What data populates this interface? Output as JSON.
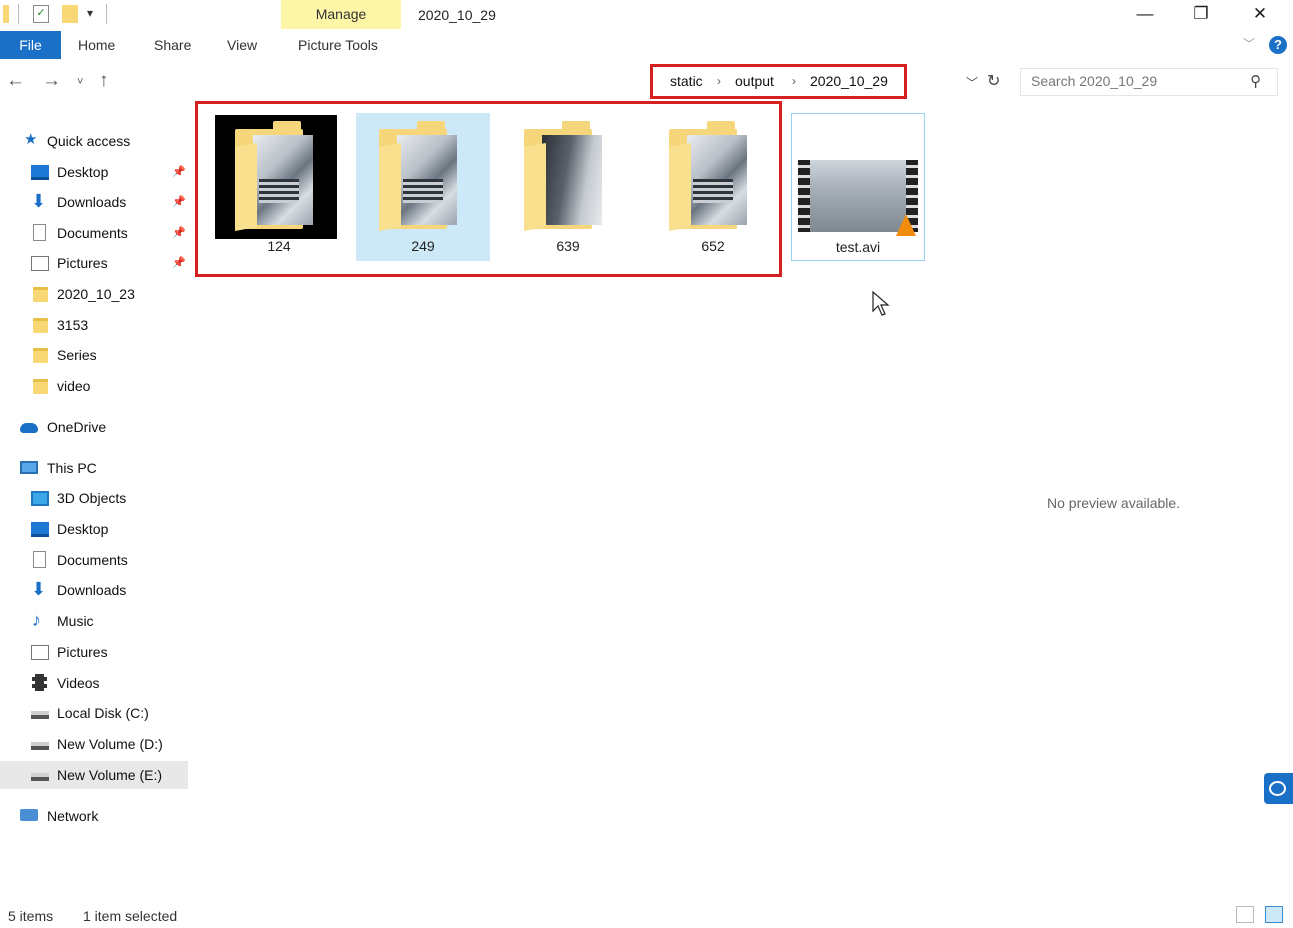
{
  "window": {
    "title": "2020_10_29",
    "contextual_tab": "Manage",
    "contextual_group": "Picture Tools",
    "minimize": "—",
    "maximize": "❐",
    "close": "✕"
  },
  "ribbon": {
    "tabs": [
      "File",
      "Home",
      "Share",
      "View",
      "Picture Tools"
    ],
    "help": "?"
  },
  "address": {
    "crumbs": [
      "static",
      "output",
      "2020_10_29"
    ],
    "search_placeholder": "Search 2020_10_29"
  },
  "nav": {
    "quick_access": "Quick access",
    "quick_items": [
      {
        "label": "Desktop",
        "icon": "desktop-icon",
        "pinned": true
      },
      {
        "label": "Downloads",
        "icon": "downloads-icon",
        "pinned": true
      },
      {
        "label": "Documents",
        "icon": "documents-icon",
        "pinned": true
      },
      {
        "label": "Pictures",
        "icon": "pictures-icon",
        "pinned": true
      },
      {
        "label": "2020_10_23",
        "icon": "folder-icon",
        "pinned": false
      },
      {
        "label": "3153",
        "icon": "folder-icon",
        "pinned": false
      },
      {
        "label": "Series",
        "icon": "folder-icon",
        "pinned": false
      },
      {
        "label": "video",
        "icon": "folder-icon",
        "pinned": false
      }
    ],
    "onedrive": "OneDrive",
    "this_pc": "This PC",
    "pc_items": [
      {
        "label": "3D Objects",
        "icon": "3d-objects-icon"
      },
      {
        "label": "Desktop",
        "icon": "desktop-icon"
      },
      {
        "label": "Documents",
        "icon": "documents-icon"
      },
      {
        "label": "Downloads",
        "icon": "downloads-icon"
      },
      {
        "label": "Music",
        "icon": "music-icon"
      },
      {
        "label": "Pictures",
        "icon": "pictures-icon"
      },
      {
        "label": "Videos",
        "icon": "videos-icon"
      },
      {
        "label": "Local Disk (C:)",
        "icon": "local-disk-icon"
      },
      {
        "label": "New Volume (D:)",
        "icon": "drive-icon"
      },
      {
        "label": "New Volume (E:)",
        "icon": "drive-icon",
        "selected": true
      }
    ],
    "network": "Network"
  },
  "files": [
    {
      "name": "124",
      "type": "folder",
      "thumb_bg": "#000000"
    },
    {
      "name": "249",
      "type": "folder",
      "selected": true
    },
    {
      "name": "639",
      "type": "folder"
    },
    {
      "name": "652",
      "type": "folder"
    },
    {
      "name": "test.avi",
      "type": "video"
    }
  ],
  "preview": {
    "message": "No preview available."
  },
  "status": {
    "count": "5 items",
    "selection": "1 item selected"
  },
  "colors": {
    "accent": "#1a6fc7",
    "highlight": "#d42020",
    "manage_tab": "#fdf6a6",
    "selection": "#cde8f7"
  }
}
